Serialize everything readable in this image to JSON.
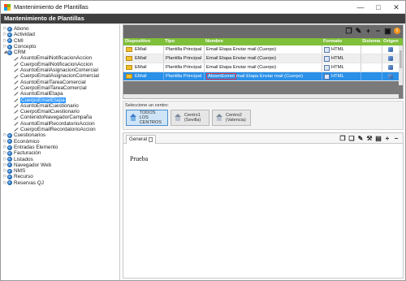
{
  "window": {
    "title": "Mantenimiento de Plantillas",
    "header": "Mantenimiento de Plantillas"
  },
  "colors": {
    "accent": "#3399ff",
    "grid_header": "#7fbf3a",
    "header_bar": "#3f3f3f",
    "selection": "#2b90e8",
    "highlight": "#e0344c"
  },
  "tree": [
    {
      "label": "Abono",
      "level": 0,
      "type": "group",
      "expanded": false
    },
    {
      "label": "Actividad",
      "level": 0,
      "type": "group",
      "expanded": false
    },
    {
      "label": "CMI",
      "level": 0,
      "type": "group",
      "expanded": false
    },
    {
      "label": "Concepto",
      "level": 0,
      "type": "group",
      "expanded": false
    },
    {
      "label": "CRM",
      "level": 0,
      "type": "group",
      "expanded": true
    },
    {
      "label": "AsuntoEmailNotificacionAccion",
      "level": 1,
      "type": "item"
    },
    {
      "label": "CuerpoEmailNotificacionAccion",
      "level": 1,
      "type": "item"
    },
    {
      "label": "AsuntoEmailAsignacionComercial",
      "level": 1,
      "type": "item"
    },
    {
      "label": "CuerpoEmailAsignacionComercial",
      "level": 1,
      "type": "item"
    },
    {
      "label": "AsuntoEmailTareaComercial",
      "level": 1,
      "type": "item"
    },
    {
      "label": "CuerpoEmailTareaComercial",
      "level": 1,
      "type": "item"
    },
    {
      "label": "AsuntoEmailEtapa",
      "level": 1,
      "type": "item"
    },
    {
      "label": "CuerpoEmailEtapa",
      "level": 1,
      "type": "item",
      "selected": true
    },
    {
      "label": "AsuntoEmailCuestionario",
      "level": 1,
      "type": "item"
    },
    {
      "label": "CuerpoEmailCuestionario",
      "level": 1,
      "type": "item"
    },
    {
      "label": "ContenidoNavegadorCampaña",
      "level": 1,
      "type": "item"
    },
    {
      "label": "AsuntoEmailRecordatorioAccion",
      "level": 1,
      "type": "item"
    },
    {
      "label": "CuerpoEmailRecordatorioAccion",
      "level": 1,
      "type": "item"
    },
    {
      "label": "Cuestionarios",
      "level": 0,
      "type": "group",
      "expanded": false
    },
    {
      "label": "Económico",
      "level": 0,
      "type": "group",
      "expanded": false
    },
    {
      "label": "Entradas Elemento",
      "level": 0,
      "type": "group",
      "expanded": false
    },
    {
      "label": "Facturación",
      "level": 0,
      "type": "group",
      "expanded": false
    },
    {
      "label": "Listados",
      "level": 0,
      "type": "group",
      "expanded": false
    },
    {
      "label": "Navegador Web",
      "level": 0,
      "type": "group",
      "expanded": false
    },
    {
      "label": "NMS",
      "level": 0,
      "type": "group",
      "expanded": false
    },
    {
      "label": "Recurso",
      "level": 0,
      "type": "group",
      "expanded": false
    },
    {
      "label": "Reservas QJ",
      "level": 0,
      "type": "group",
      "expanded": false
    }
  ],
  "grid": {
    "columns": [
      "Dispositivo",
      "Tipo",
      "Nombre",
      "Formato",
      "Sistema",
      "Origen"
    ],
    "rows": [
      {
        "dispositivo": "EMail",
        "tipo": "Plantilla Principal",
        "nombre_pre": "",
        "nombre_hl": "",
        "nombre": "Email Etapa Enviar mail (Cuerpo)",
        "formato": "HTML",
        "selected": false
      },
      {
        "dispositivo": "EMail",
        "tipo": "Plantilla Principal",
        "nombre_pre": "",
        "nombre_hl": "",
        "nombre": "Email Etapa Enviar mail (Cuerpo)",
        "formato": "HTML",
        "selected": false
      },
      {
        "dispositivo": "EMail",
        "tipo": "Plantilla Principal",
        "nombre_pre": "",
        "nombre_hl": "",
        "nombre": "Email Etapa Enviar mail (Cuerpo)",
        "formato": "HTML",
        "selected": false
      },
      {
        "dispositivo": "EMail",
        "tipo": "Plantilla Principal",
        "nombre_pre": "",
        "nombre_hl": "AbsenEsmet",
        "nombre": "mail Etapa Enviar mail (Cuerpo)",
        "formato": "HTML",
        "selected": true
      }
    ]
  },
  "centros": {
    "label": "Seleccione un centro:",
    "buttons": [
      {
        "line1": "TODOS LOS",
        "line2": "CENTROS",
        "active": true
      },
      {
        "line1": "Centro1",
        "line2": "(Sevilla)",
        "active": false
      },
      {
        "line1": "Centro2",
        "line2": "(Valencia)",
        "active": false
      }
    ]
  },
  "editor": {
    "tab_label": "General",
    "content": "Prueba"
  }
}
